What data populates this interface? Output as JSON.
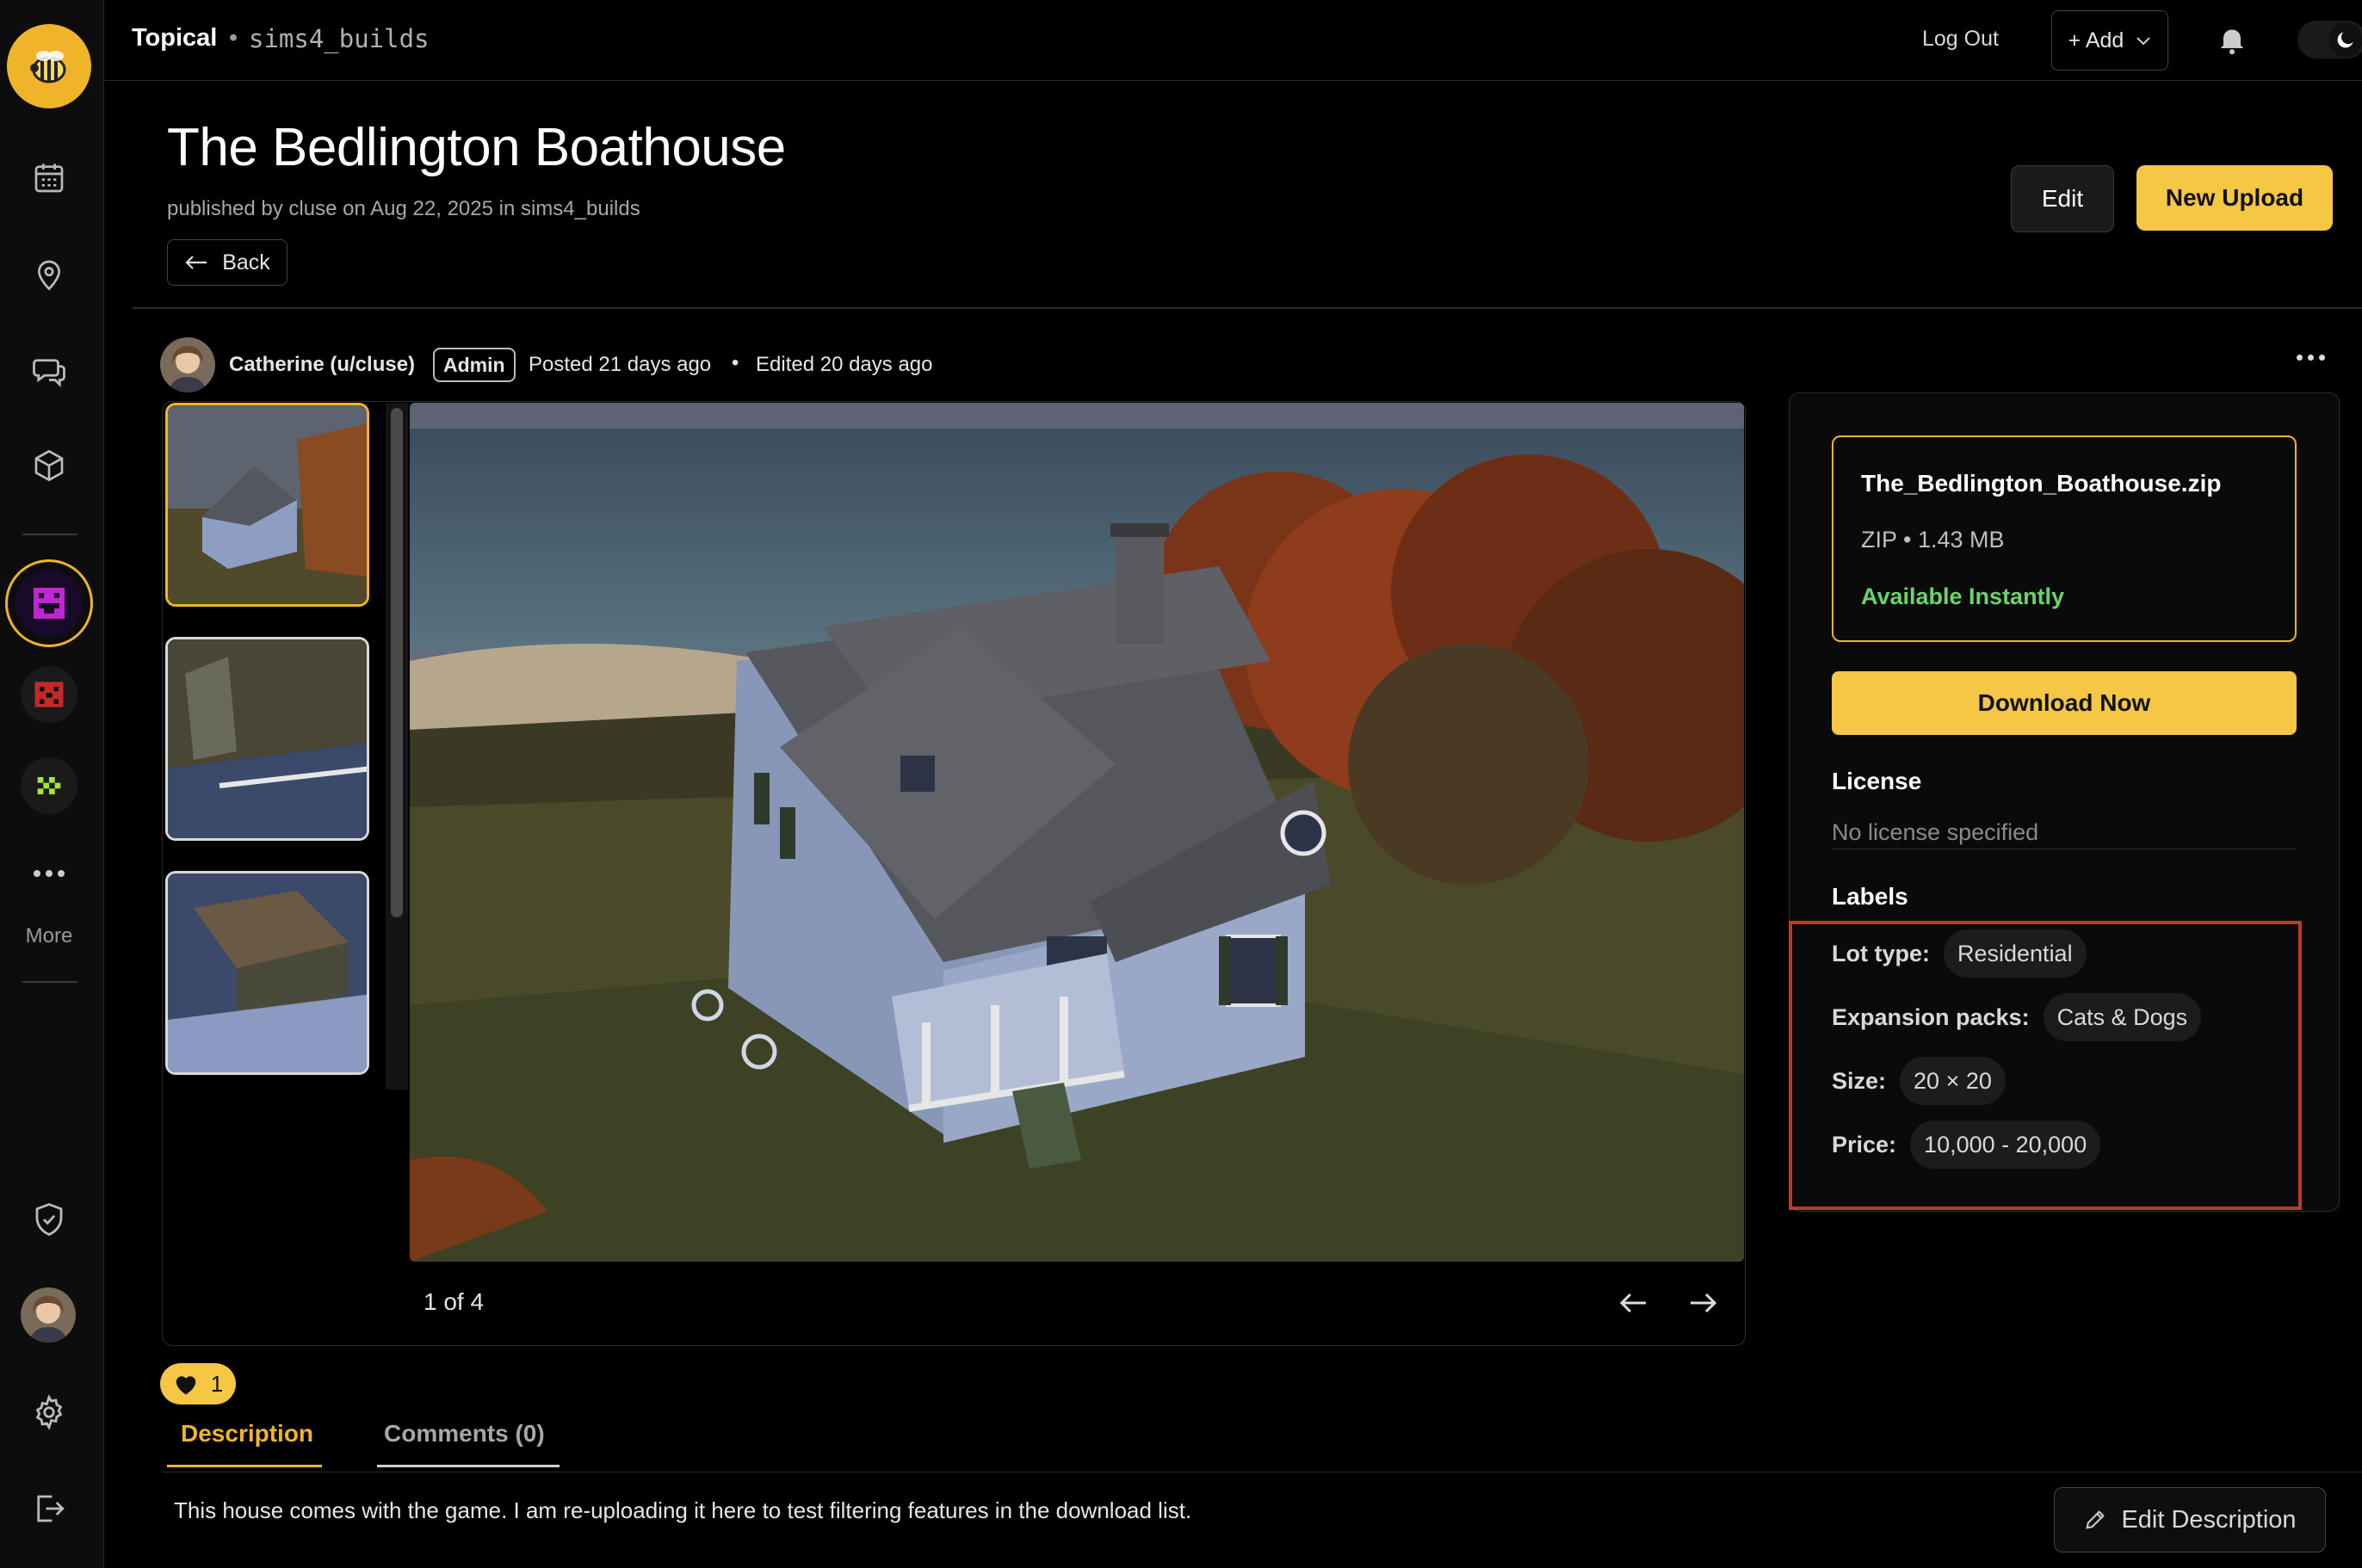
{
  "topbar": {
    "brand": "Topical",
    "separator": "•",
    "community": "sims4_builds",
    "logout_label": "Log Out",
    "add_label": "+ Add"
  },
  "sidebar": {
    "more_label": "More"
  },
  "header": {
    "title": "The Bedlington Boathouse",
    "published_line": "published by cluse on Aug 22, 2025 in sims4_builds",
    "back_label": "Back",
    "edit_label": "Edit",
    "new_upload_label": "New Upload"
  },
  "post": {
    "author": "Catherine (u/cluse)",
    "role_badge": "Admin",
    "posted": "Posted 21 days ago",
    "bullet": "•",
    "edited": "Edited 20 days ago"
  },
  "gallery": {
    "counter": "1 of 4",
    "active_index": 0,
    "visible_thumbnails": 3
  },
  "download": {
    "file_name": "The_Bedlington_Boathouse.zip",
    "file_meta": "ZIP • 1.43 MB",
    "availability": "Available Instantly",
    "button_label": "Download Now"
  },
  "license": {
    "heading": "License",
    "value": "No license specified"
  },
  "labels": {
    "heading": "Labels",
    "rows": [
      {
        "key": "Lot type:",
        "value": "Residential"
      },
      {
        "key": "Expansion packs:",
        "value": "Cats & Dogs"
      },
      {
        "key": "Size:",
        "value": "20 × 20"
      },
      {
        "key": "Price:",
        "value": "10,000 - 20,000"
      }
    ]
  },
  "reactions": {
    "like_count": "1"
  },
  "tabs": {
    "description": "Description",
    "comments": "Comments (0)"
  },
  "description": {
    "text": "This house comes with the game. I am re-uploading it here to test filtering features in the download list.",
    "edit_label": "Edit Description"
  },
  "colors": {
    "accent": "#f6c744",
    "available": "#6bd46b",
    "highlight": "#c0392b"
  }
}
